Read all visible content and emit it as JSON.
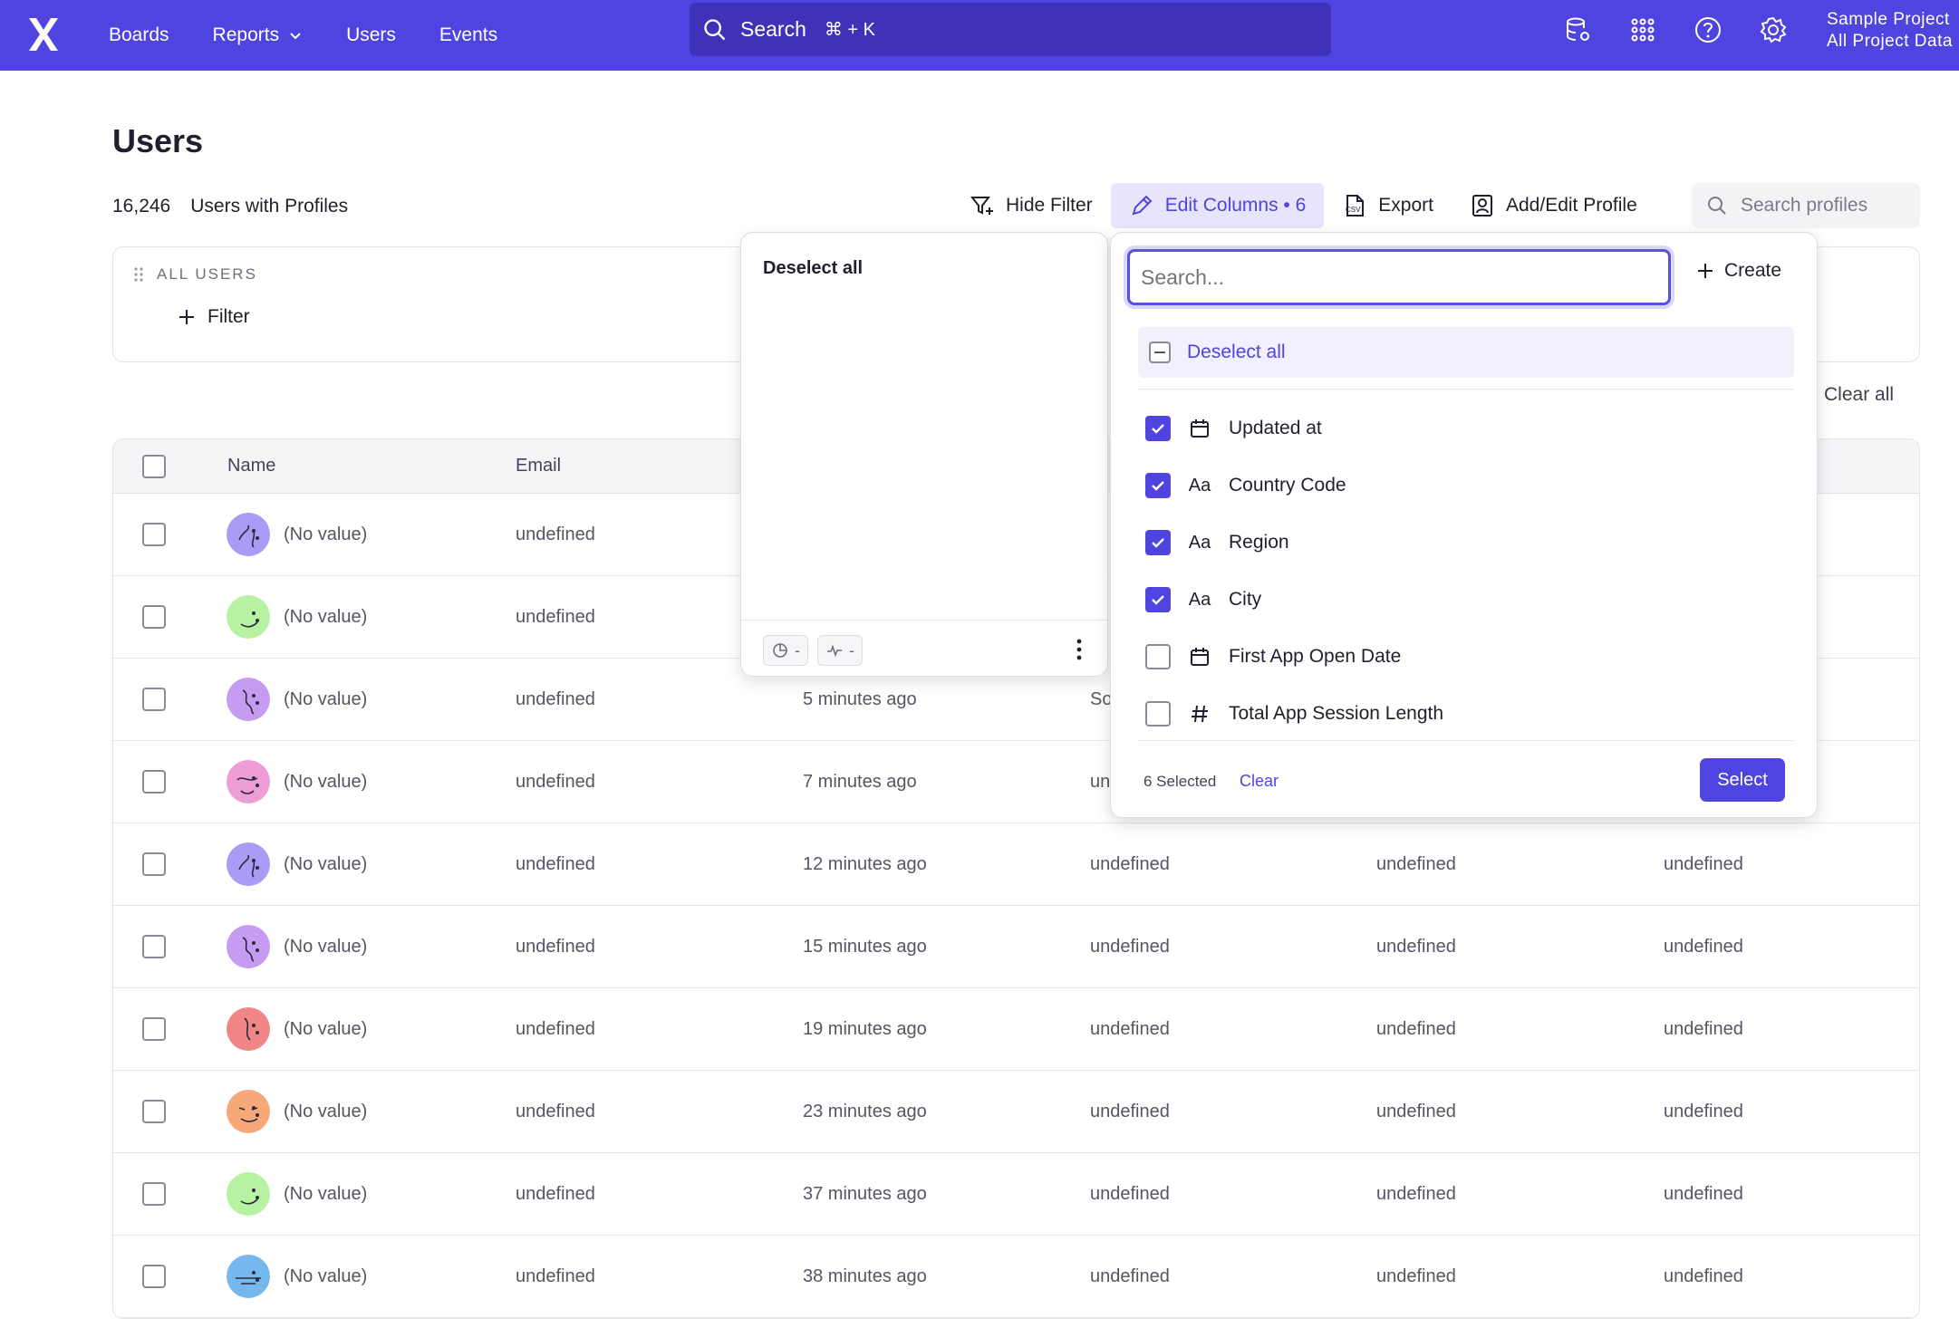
{
  "nav": {
    "links": [
      {
        "label": "Boards",
        "has_chevron": false
      },
      {
        "label": "Reports",
        "has_chevron": true
      },
      {
        "label": "Users",
        "has_chevron": false
      },
      {
        "label": "Events",
        "has_chevron": false
      }
    ],
    "search_label": "Search",
    "search_shortcut": "⌘ + K",
    "project_line1": "Sample Project",
    "project_line2": "All Project Data",
    "icons": [
      "data-settings-icon",
      "apps-grid-icon",
      "help-icon",
      "gear-icon"
    ],
    "brand_color": "#4f44e0"
  },
  "page": {
    "title": "Users",
    "user_count": "16,246",
    "user_count_label": "Users with Profiles"
  },
  "toolbar": {
    "hide_filter": "Hide Filter",
    "edit_columns": "Edit Columns • 6",
    "export": "Export",
    "add_edit_profile": "Add/Edit Profile",
    "search_placeholder": "Search profiles"
  },
  "filter": {
    "segment_label": "ALL USERS",
    "add_filter": "Filter",
    "clear_all": "Clear all"
  },
  "table": {
    "headers": [
      "Name",
      "Email"
    ],
    "rows": [
      {
        "name": "(No value)",
        "email": "undefined",
        "updated": "",
        "c4": "",
        "c5": "",
        "c6": "",
        "avatar_color": "#a89cf5"
      },
      {
        "name": "(No value)",
        "email": "undefined",
        "updated": "",
        "c4": "",
        "c5": "",
        "c6": "",
        "avatar_color": "#b6f2a2"
      },
      {
        "name": "(No value)",
        "email": "undefined",
        "updated": "5 minutes ago",
        "c4": "So",
        "c5": "",
        "c6": "",
        "avatar_color": "#c59cf2"
      },
      {
        "name": "(No value)",
        "email": "undefined",
        "updated": "7 minutes ago",
        "c4": "un",
        "c5": "",
        "c6": "",
        "avatar_color": "#ee9ed5"
      },
      {
        "name": "(No value)",
        "email": "undefined",
        "updated": "12 minutes ago",
        "c4": "undefined",
        "c5": "undefined",
        "c6": "undefined",
        "avatar_color": "#a89cf5"
      },
      {
        "name": "(No value)",
        "email": "undefined",
        "updated": "15 minutes ago",
        "c4": "undefined",
        "c5": "undefined",
        "c6": "undefined",
        "avatar_color": "#c59cf2"
      },
      {
        "name": "(No value)",
        "email": "undefined",
        "updated": "19 minutes ago",
        "c4": "undefined",
        "c5": "undefined",
        "c6": "undefined",
        "avatar_color": "#f08686"
      },
      {
        "name": "(No value)",
        "email": "undefined",
        "updated": "23 minutes ago",
        "c4": "undefined",
        "c5": "undefined",
        "c6": "undefined",
        "avatar_color": "#f7a878"
      },
      {
        "name": "(No value)",
        "email": "undefined",
        "updated": "37 minutes ago",
        "c4": "undefined",
        "c5": "undefined",
        "c6": "undefined",
        "avatar_color": "#b6f2a2"
      },
      {
        "name": "(No value)",
        "email": "undefined",
        "updated": "38 minutes ago",
        "c4": "undefined",
        "c5": "undefined",
        "c6": "undefined",
        "avatar_color": "#76b8ee"
      }
    ]
  },
  "selected_panel": {
    "deselect_all": "Deselect all",
    "chip1_value": "-",
    "chip2_value": "-"
  },
  "columns_panel": {
    "search_placeholder": "Search...",
    "create": "Create",
    "deselect_all": "Deselect all",
    "items": [
      {
        "label": "Updated at",
        "type": "date",
        "checked": true
      },
      {
        "label": "Country Code",
        "type": "text",
        "checked": true
      },
      {
        "label": "Region",
        "type": "text",
        "checked": true
      },
      {
        "label": "City",
        "type": "text",
        "checked": true
      },
      {
        "label": "First App Open Date",
        "type": "date",
        "checked": false
      },
      {
        "label": "Total App Session Length",
        "type": "number",
        "checked": false
      }
    ],
    "type_text_glyph": "Aa",
    "selected_count": "6 Selected",
    "clear": "Clear",
    "select": "Select"
  }
}
